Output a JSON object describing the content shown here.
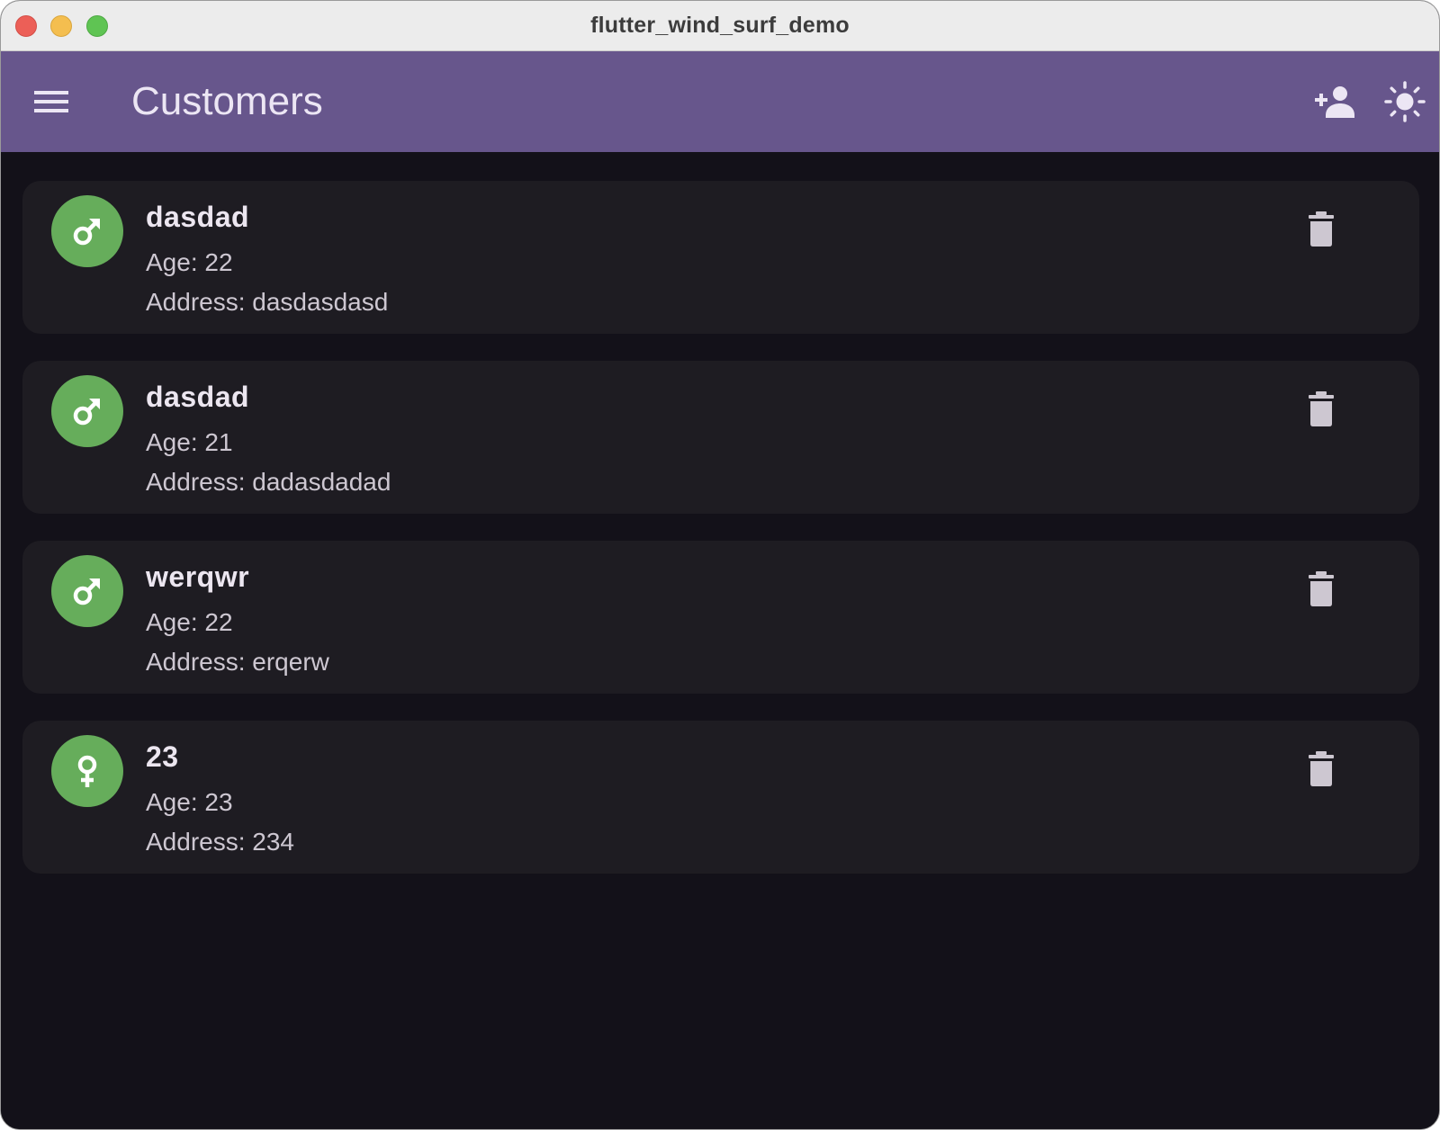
{
  "window": {
    "title": "flutter_wind_surf_demo"
  },
  "appbar": {
    "title": "Customers",
    "menu_icon": "menu-icon",
    "add_icon": "person-add-icon",
    "theme_icon": "light-mode-icon",
    "color": "#67568c"
  },
  "colors": {
    "background": "#131119",
    "card": "#1e1c22",
    "avatar": "#66ad5b"
  },
  "customers": [
    {
      "name": "dasdad",
      "age": "Age: 22",
      "address": "Address: dasdasdasd",
      "gender_icon": "male-icon"
    },
    {
      "name": "dasdad",
      "age": "Age: 21",
      "address": "Address: dadasdadad",
      "gender_icon": "male-icon"
    },
    {
      "name": "werqwr",
      "age": "Age: 22",
      "address": "Address: erqerw",
      "gender_icon": "male-icon"
    },
    {
      "name": "23",
      "age": "Age: 23",
      "address": "Address: 234",
      "gender_icon": "female-icon"
    }
  ]
}
